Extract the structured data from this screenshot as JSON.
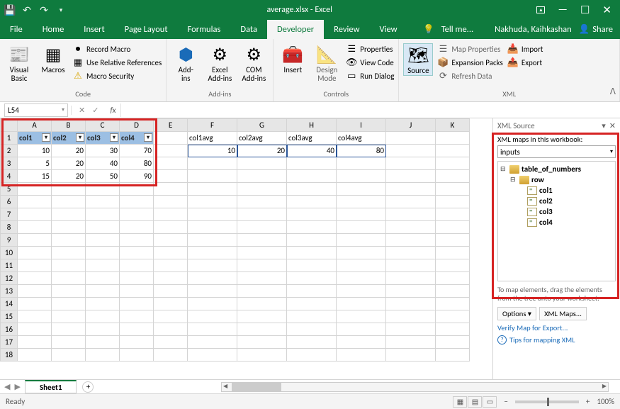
{
  "title": "average.xlsx - Excel",
  "user": "Nakhuda, Kaihkashan",
  "share_label": "Share",
  "tell_me": "Tell me...",
  "tabs": [
    "File",
    "Home",
    "Insert",
    "Page Layout",
    "Formulas",
    "Data",
    "Developer",
    "Review",
    "View"
  ],
  "active_tab": "Developer",
  "ribbon": {
    "code": {
      "label": "Code",
      "vb": "Visual\nBasic",
      "macros": "Macros",
      "record": "Record Macro",
      "relref": "Use Relative References",
      "security": "Macro Security"
    },
    "addins": {
      "label": "Add-ins",
      "addins": "Add-\nins",
      "excel": "Excel\nAdd-ins",
      "com": "COM\nAdd-ins"
    },
    "controls": {
      "label": "Controls",
      "insert": "Insert",
      "design": "Design\nMode",
      "props": "Properties",
      "view": "View Code",
      "run": "Run Dialog"
    },
    "xml": {
      "label": "XML",
      "source": "Source",
      "mapprops": "Map Properties",
      "expansion": "Expansion Packs",
      "refresh": "Refresh Data",
      "import": "Import",
      "export": "Export"
    }
  },
  "namebox": "L54",
  "cols": [
    "A",
    "B",
    "C",
    "D",
    "E",
    "F",
    "G",
    "H",
    "I",
    "J",
    "K"
  ],
  "table_headers": [
    "col1",
    "col2",
    "col3",
    "col4"
  ],
  "table_rows": [
    [
      "10",
      "20",
      "30",
      "70"
    ],
    [
      "5",
      "20",
      "40",
      "80"
    ],
    [
      "15",
      "20",
      "50",
      "90"
    ]
  ],
  "avg_headers": [
    "col1avg",
    "col2avg",
    "col3avg",
    "col4avg"
  ],
  "avg_values": [
    "10",
    "20",
    "40",
    "80"
  ],
  "xml_pane": {
    "title": "XML Source",
    "maps_label": "XML maps in this workbook:",
    "selected_map": "inputs",
    "root": "table_of_numbers",
    "row": "row",
    "leaves": [
      "col1",
      "col2",
      "col3",
      "col4"
    ],
    "hint": "To map elements, drag the elements from the tree onto your worksheet.",
    "options": "Options",
    "xmlmaps": "XML Maps...",
    "verify": "Verify Map for Export...",
    "tips": "Tips for mapping XML"
  },
  "sheet": "Sheet1",
  "status": "Ready",
  "zoom": "100%"
}
